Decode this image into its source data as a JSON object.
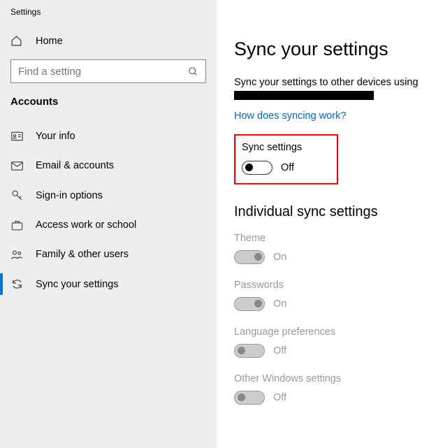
{
  "window_title": "Settings",
  "home_label": "Home",
  "search_placeholder": "Find a setting",
  "section_header": "Accounts",
  "nav": [
    {
      "label": "Your info"
    },
    {
      "label": "Email & accounts"
    },
    {
      "label": "Sign-in options"
    },
    {
      "label": "Access work or school"
    },
    {
      "label": "Family & other users"
    },
    {
      "label": "Sync your settings"
    }
  ],
  "page": {
    "title": "Sync your settings",
    "description": "Sync your settings to other devices using",
    "link": "How does syncing work?",
    "main_toggle_label": "Sync settings",
    "main_toggle_state": "Off",
    "sub_header": "Individual sync settings",
    "individual": [
      {
        "label": "Theme",
        "state": "On",
        "on": true
      },
      {
        "label": "Passwords",
        "state": "On",
        "on": true
      },
      {
        "label": "Language preferences",
        "state": "Off",
        "on": false
      },
      {
        "label": "Other Windows settings",
        "state": "Off",
        "on": false
      }
    ]
  }
}
